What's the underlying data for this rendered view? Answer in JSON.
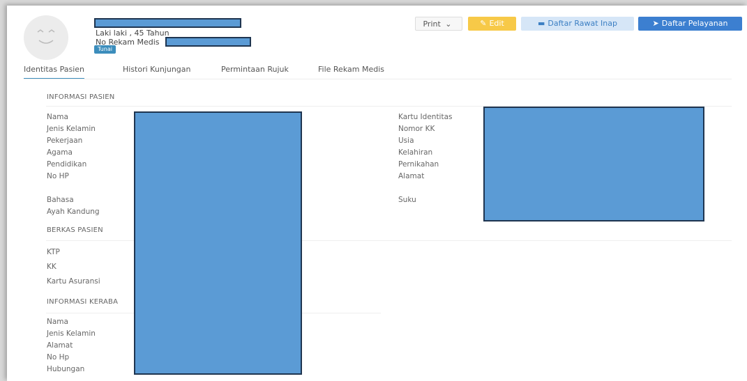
{
  "header": {
    "gender_age": "Laki laki , 45 Tahun",
    "rekam_medis_label": "No Rekam Medis",
    "payment_badge": "Tunai"
  },
  "actions": {
    "print": "Print",
    "edit": "Edit",
    "rawat_inap": "Daftar Rawat Inap",
    "pelayanan": "Daftar Pelayanan"
  },
  "icons": {
    "print_dropdown": "chevron-down-icon",
    "edit": "pencil-icon",
    "rawat_inap": "bed-icon",
    "pelayanan": "send-icon"
  },
  "tabs": [
    "Identitas Pasien",
    "Histori Kunjungan",
    "Permintaan Rujuk",
    "File Rekam Medis"
  ],
  "sections": {
    "informasi_pasien": {
      "title": "INFORMASI PASIEN",
      "left_labels": [
        "Nama",
        "Jenis Kelamin",
        "Pekerjaan",
        "Agama",
        "Pendidikan",
        "No HP",
        "Bahasa",
        "Ayah Kandung"
      ],
      "right_labels": [
        "Kartu Identitas",
        "Nomor KK",
        "Usia",
        "Kelahiran",
        "Pernikahan",
        "Alamat",
        "Suku"
      ]
    },
    "berkas_pasien": {
      "title": "BERKAS PASIEN",
      "labels": [
        "KTP",
        "KK",
        "Kartu Asuransi"
      ]
    },
    "informasi_kerabat": {
      "title": "INFORMASI KERABA",
      "labels": [
        "Nama",
        "Jenis Kelamin",
        "Alamat",
        "No Hp",
        "Hubungan"
      ]
    }
  },
  "colors": {
    "redaction": "#5b9bd5",
    "edit": "#f7c948",
    "primary": "#3c7fd0",
    "badge": "#3c8dbc"
  }
}
